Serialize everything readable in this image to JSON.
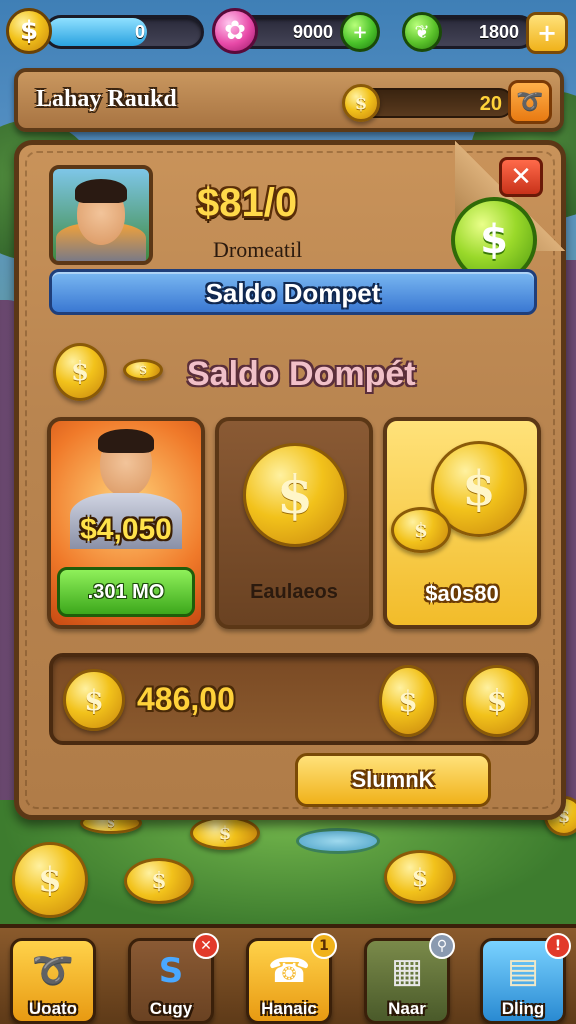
{
  "hud": {
    "left_value": "0",
    "left_progress_fraction": 0.65,
    "middle_value": "9000",
    "right_value": "1800"
  },
  "title_bar": {
    "title": "Lahay Raukd",
    "progress_value": "20"
  },
  "panel": {
    "amount": "$81/0",
    "sub_label": "Dromeatil",
    "wallet_bar_label": "Saldo Dompet",
    "section_title": "Saldo Dompét",
    "cards": [
      {
        "amount_label": "$4,050",
        "button_label": ".301 MO"
      },
      {
        "label": "Eaulaeos"
      },
      {
        "label": "$a0s80"
      }
    ],
    "strip_amount": "486,00",
    "action_button": "SlumnK"
  },
  "nav": {
    "items": [
      {
        "label": "Uoato",
        "icon": "ribbon-icon"
      },
      {
        "label": "Cugy",
        "icon": "s-coin-icon"
      },
      {
        "label": "Hanaic",
        "icon": "phone-icon"
      },
      {
        "label": "Naar",
        "icon": "cash-register-icon"
      },
      {
        "label": "Dling",
        "icon": "money-stack-icon"
      }
    ]
  }
}
